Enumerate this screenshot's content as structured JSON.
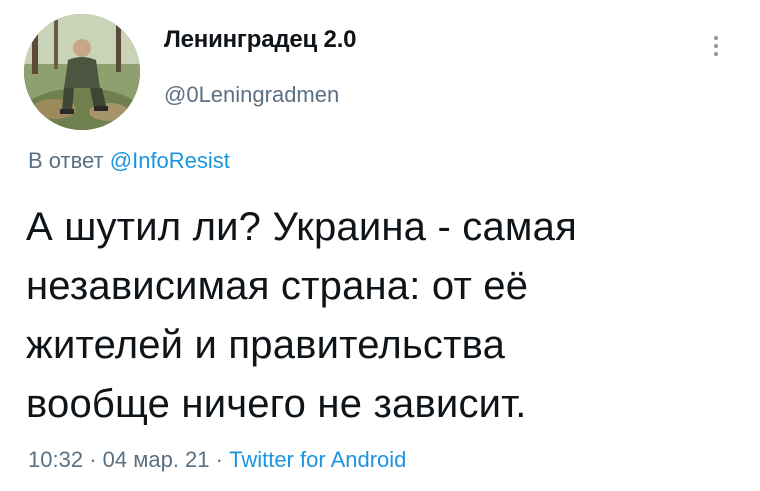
{
  "author": {
    "display_name": "Ленинградец 2.0",
    "handle": "@0Leningradmen"
  },
  "reply": {
    "prefix": "В ответ",
    "mention": "@InfoResist"
  },
  "tweet": {
    "lines": [
      "А шутил ли? Украина - самая",
      "независимая страна: от её",
      "жителей и правительства",
      "вообще ничего не зависит."
    ],
    "time": "10:32",
    "separator": "·",
    "date": "04 мар. 21",
    "source": "Twitter for Android"
  },
  "icons": {
    "more": "more-vertical-icon",
    "avatar": "profile-photo"
  },
  "colors": {
    "text": "#0f1419",
    "secondary": "#5b7083",
    "link": "#1b95e0"
  }
}
